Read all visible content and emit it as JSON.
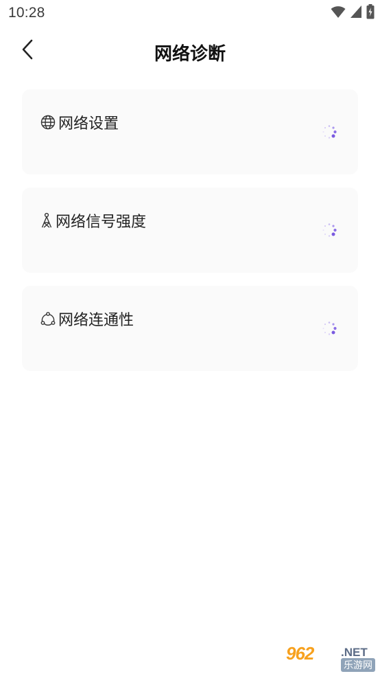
{
  "status_bar": {
    "time": "10:28",
    "icons": [
      "wifi-icon",
      "signal-icon",
      "battery-icon"
    ]
  },
  "header": {
    "title": "网络诊断",
    "back_icon": "chevron-left-icon"
  },
  "items": [
    {
      "label": "网络设置",
      "icon": "globe-icon",
      "status_icon": "loading-spinner"
    },
    {
      "label": "网络信号强度",
      "icon": "signal-tower-icon",
      "status_icon": "loading-spinner"
    },
    {
      "label": "网络连通性",
      "icon": "connectivity-icon",
      "status_icon": "loading-spinner"
    }
  ],
  "watermark": {
    "brand": "962",
    "domain": ".NET",
    "cn": "乐游网"
  },
  "colors": {
    "accent": "#7a5ae0",
    "card_bg": "#fafafa",
    "text": "#222222"
  }
}
